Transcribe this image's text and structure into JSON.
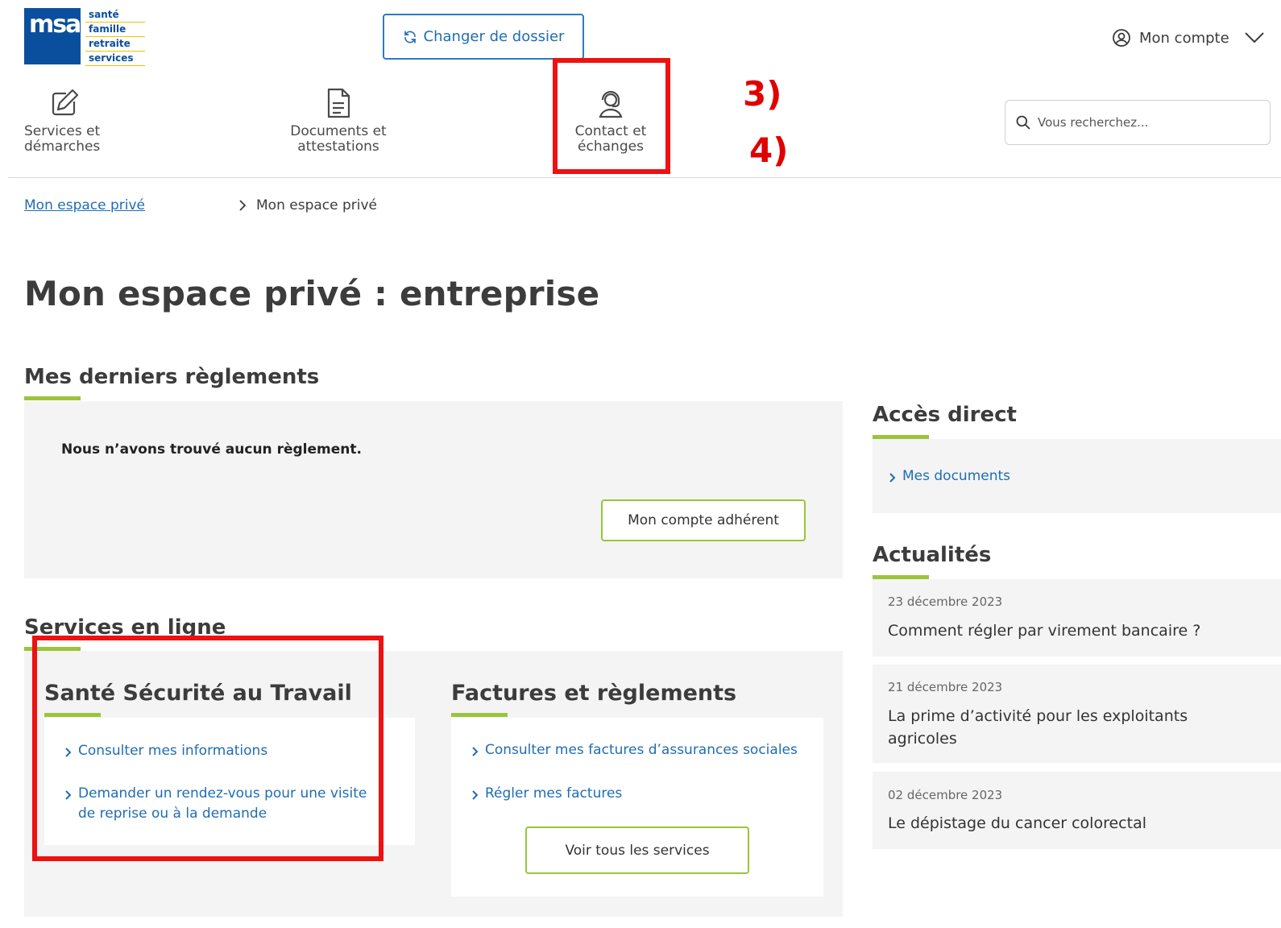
{
  "logo": {
    "mark": "msa",
    "words": [
      "santé",
      "famille",
      "retraite",
      "services"
    ]
  },
  "header": {
    "change_folder_label": "Changer de dossier",
    "account_label": "Mon compte"
  },
  "nav": {
    "services": "Services et démarches",
    "documents": "Documents et attestations",
    "contact": "Contact et échanges"
  },
  "search": {
    "placeholder": "Vous recherchez..."
  },
  "annotations": {
    "step3": "3)",
    "step4": "4)"
  },
  "breadcrumb": {
    "root": "Mon espace privé",
    "current": "Mon espace privé"
  },
  "page_title": "Mon espace privé : entreprise",
  "payments": {
    "heading": "Mes derniers règlements",
    "empty_message": "Nous n’avons trouvé aucun règlement.",
    "account_button": "Mon compte adhérent"
  },
  "services_online": {
    "heading": "Services en ligne",
    "sst": {
      "title": "Santé Sécurité au Travail",
      "links": [
        "Consulter mes informations",
        "Demander un rendez-vous pour une visite de reprise ou à la demande"
      ]
    },
    "invoices": {
      "title": "Factures et règlements",
      "links": [
        "Consulter mes factures d’assurances sociales",
        "Régler mes factures"
      ],
      "all_services_button": "Voir tous les services"
    }
  },
  "direct_access": {
    "heading": "Accès direct",
    "links": [
      "Mes documents"
    ]
  },
  "news": {
    "heading": "Actualités",
    "items": [
      {
        "date": "23 décembre 2023",
        "title": "Comment régler par virement bancaire ?"
      },
      {
        "date": "21 décembre 2023",
        "title": "La prime d’activité pour les exploitants agricoles"
      },
      {
        "date": "02 décembre 2023",
        "title": "Le dépistage du cancer colorectal"
      }
    ]
  },
  "colors": {
    "accent_green": "#9bc43b",
    "link_blue": "#1f6db3",
    "brand_blue": "#0a4f9e",
    "annotation_red": "#ee1111"
  }
}
